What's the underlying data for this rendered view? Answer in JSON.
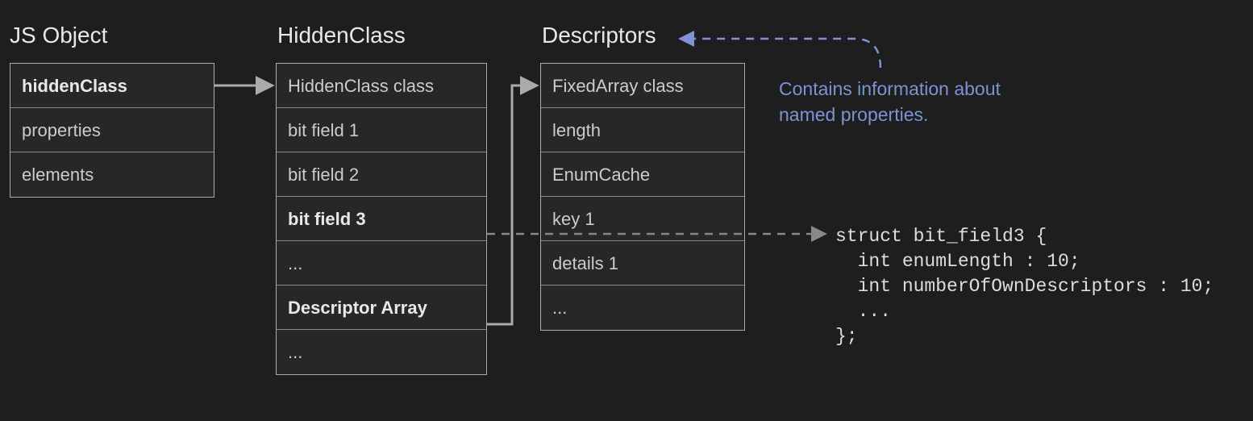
{
  "headings": {
    "jsobject": "JS Object",
    "hiddenclass": "HiddenClass",
    "descriptors": "Descriptors"
  },
  "jsobject": {
    "rows": {
      "hiddenclass": "hiddenClass",
      "properties": "properties",
      "elements": "elements"
    }
  },
  "hiddenclass": {
    "rows": {
      "classref": "HiddenClass class",
      "bitfield1": "bit field 1",
      "bitfield2": "bit field 2",
      "bitfield3": "bit field 3",
      "ellipsis1": "...",
      "descriptorarray": "Descriptor Array",
      "ellipsis2": "..."
    }
  },
  "descriptors": {
    "rows": {
      "classref": "FixedArray class",
      "length": "length",
      "enumcache": "EnumCache",
      "key1": "key 1",
      "details1": "details 1",
      "ellipsis": "..."
    }
  },
  "annotation": {
    "line1": "Contains information about",
    "line2": "named properties."
  },
  "code": {
    "line1": "struct bit_field3 {",
    "line2": "  int enumLength : 10;",
    "line3": "  int numberOfOwnDescriptors : 10;",
    "line4": "  ...",
    "line5": "};"
  }
}
